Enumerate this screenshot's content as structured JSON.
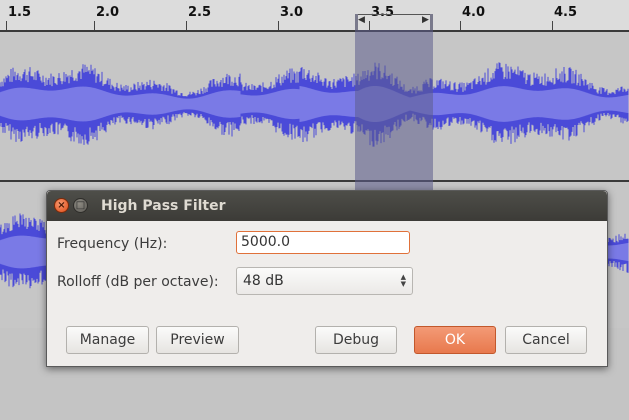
{
  "ruler": {
    "labels": [
      "1.5",
      "2.0",
      "2.5",
      "3.0",
      "3.5",
      "4.0",
      "4.5"
    ]
  },
  "dialog": {
    "title": "High Pass Filter",
    "frequency": {
      "label": "Frequency (Hz):",
      "value": "5000.0"
    },
    "rolloff": {
      "label": "Rolloff (dB per octave):",
      "value": "48 dB"
    },
    "buttons": {
      "manage": "Manage",
      "preview": "Preview",
      "debug": "Debug",
      "ok": "OK",
      "cancel": "Cancel"
    }
  },
  "colors": {
    "waveform": "#4a4ad8",
    "waveform_rms": "#7a7ae6",
    "selection": "#5c5c8c",
    "ok_button": "#e8794d"
  }
}
